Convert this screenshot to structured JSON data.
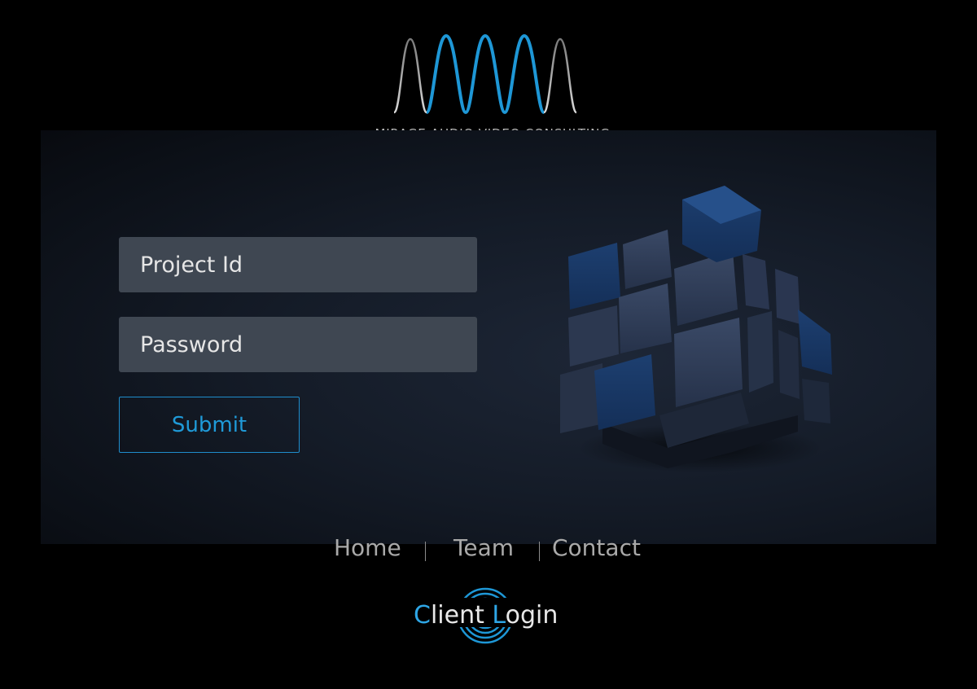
{
  "brand": {
    "logo_icon": "waveform-logo-icon",
    "name": "MIRAGE AUDIO VIDEO CONSULTING",
    "accent_color": "#1e97d6"
  },
  "form": {
    "project_id_placeholder": "Project Id",
    "password_placeholder": "Password",
    "submit_label": "Submit"
  },
  "hero_image": {
    "icon": "cube-icon"
  },
  "nav": {
    "items": [
      {
        "label": "Home"
      },
      {
        "label": "Team"
      },
      {
        "label": "Contact"
      }
    ]
  },
  "client_login": {
    "first_letter": "C",
    "rest_first_word": "lient ",
    "second_letter": "L",
    "rest_second_word": "ogin",
    "icon": "concentric-rings-icon"
  }
}
